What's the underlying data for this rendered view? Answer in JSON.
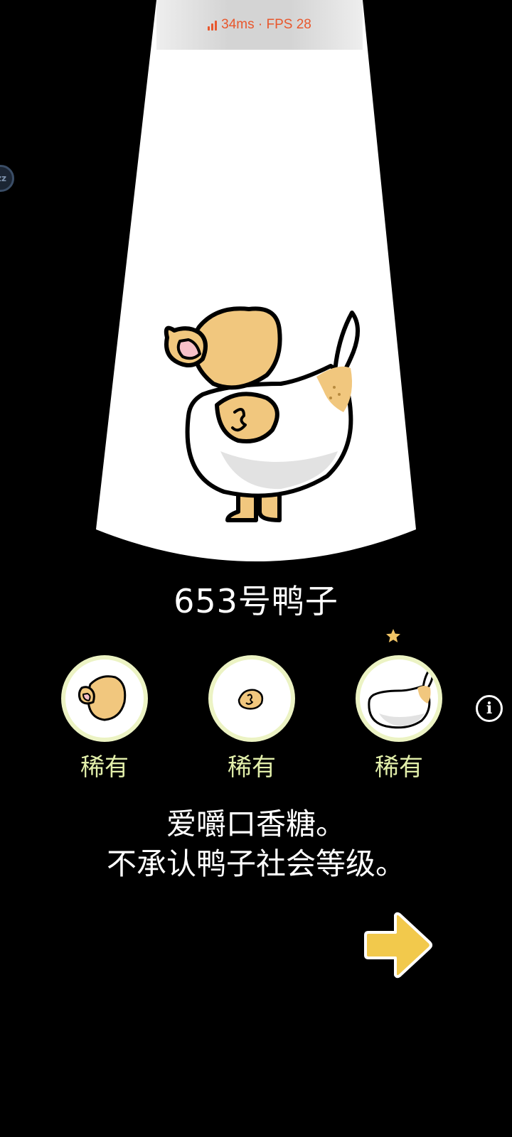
{
  "status": {
    "perf_text": "34ms · FPS 28",
    "color": "#e8572d"
  },
  "sleep_indicator": {
    "label": "zz",
    "icon": "sleep-icon"
  },
  "duck": {
    "name": "653号鸭子",
    "description_lines": [
      "爱嚼口香糖。",
      "不承认鸭子社会等级。"
    ]
  },
  "parts": [
    {
      "label": "稀有",
      "icon": "duck-head-part-icon"
    },
    {
      "label": "稀有",
      "icon": "duck-wing-part-icon"
    },
    {
      "label": "稀有",
      "icon": "duck-body-part-icon"
    }
  ],
  "colors": {
    "background": "#000000",
    "spotlight": "#ffffff",
    "rarity_text": "#e2efaa",
    "part_ring": "#ecf3c4",
    "next_arrow": "#f2c94c",
    "duck_tan": "#f1c77e",
    "star": "#f0c466"
  }
}
